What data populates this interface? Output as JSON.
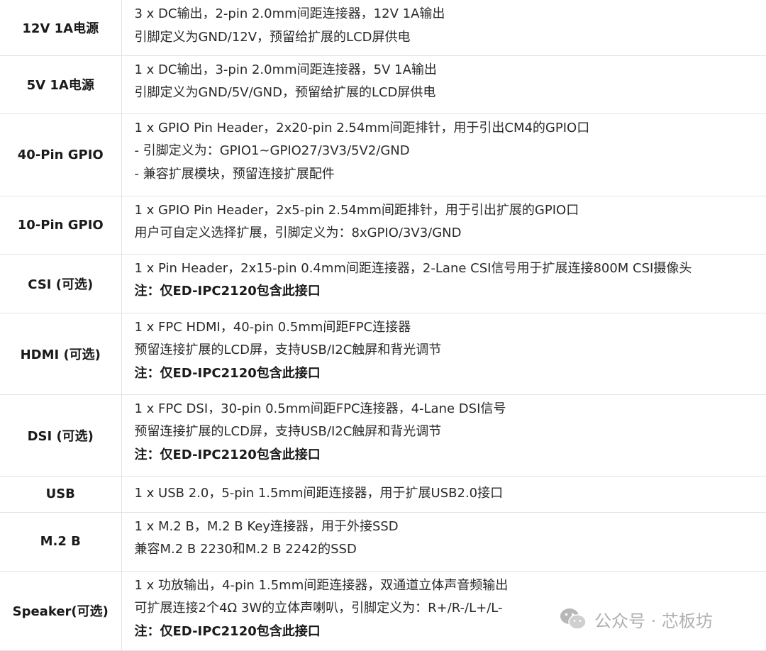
{
  "rows": [
    {
      "key": "12V 1A电源",
      "lines": [
        "3 x DC输出，2-pin 2.0mm间距连接器，12V 1A输出",
        "引脚定义为GND/12V，预留给扩展的LCD屏供电"
      ],
      "note": null
    },
    {
      "key": "5V 1A电源",
      "lines": [
        "1 x DC输出，3-pin 2.0mm间距连接器，5V 1A输出",
        "引脚定义为GND/5V/GND，预留给扩展的LCD屏供电"
      ],
      "note": null
    },
    {
      "key": "40-Pin GPIO",
      "lines": [
        "1 x GPIO Pin Header，2x20-pin 2.54mm间距排针，用于引出CM4的GPIO口",
        "- 引脚定义为：GPIO1~GPIO27/3V3/5V2/GND",
        "- 兼容扩展模块，预留连接扩展配件"
      ],
      "note": null
    },
    {
      "key": "10-Pin GPIO",
      "lines": [
        "1 x GPIO Pin Header，2x5-pin 2.54mm间距排针，用于引出扩展的GPIO口",
        "用户可自定义选择扩展，引脚定义为：8xGPIO/3V3/GND"
      ],
      "note": null
    },
    {
      "key": "CSI (可选)",
      "lines": [
        "1 x Pin Header，2x15-pin 0.4mm间距连接器，2-Lane CSI信号用于扩展连接800M CSI摄像头"
      ],
      "note": "注：仅ED-IPC2120包含此接口"
    },
    {
      "key": "HDMI (可选)",
      "lines": [
        "1 x FPC HDMI，40-pin 0.5mm间距FPC连接器",
        "预留连接扩展的LCD屏，支持USB/I2C触屏和背光调节"
      ],
      "note": "注：仅ED-IPC2120包含此接口"
    },
    {
      "key": "DSI (可选)",
      "lines": [
        "1 x FPC DSI，30-pin 0.5mm间距FPC连接器，4-Lane DSI信号",
        "预留连接扩展的LCD屏，支持USB/I2C触屏和背光调节"
      ],
      "note": "注：仅ED-IPC2120包含此接口"
    },
    {
      "key": "USB",
      "lines": [
        "1 x USB 2.0，5-pin 1.5mm间距连接器，用于扩展USB2.0接口"
      ],
      "note": null
    },
    {
      "key": "M.2 B",
      "lines": [
        "1 x M.2 B，M.2 B Key连接器，用于外接SSD",
        "兼容M.2 B 2230和M.2 B 2242的SSD"
      ],
      "note": null
    },
    {
      "key": "Speaker(可选)",
      "lines": [
        "1 x 功放输出，4-pin 1.5mm间距连接器，双通道立体声音频输出",
        "可扩展连接2个4Ω 3W的立体声喇叭，引脚定义为：R+/R-/L+/L-"
      ],
      "note": "注：仅ED-IPC2120包含此接口"
    }
  ],
  "watermark": {
    "text": "公众号 · 芯板坊",
    "icon": "wechat-icon"
  },
  "colors": {
    "border": "#e3e3e3",
    "text": "#2a2a2a",
    "watermark": "#b0b0b0"
  }
}
